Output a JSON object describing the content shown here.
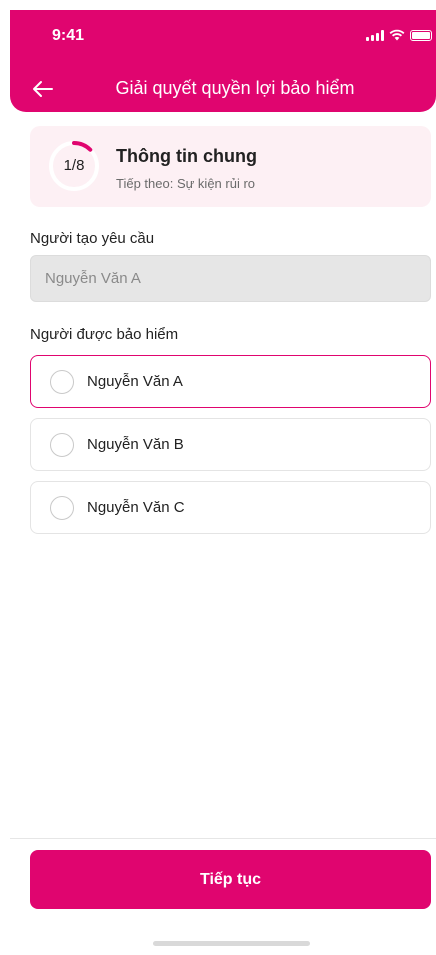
{
  "status_bar": {
    "time": "9:41"
  },
  "header": {
    "title": "Giải quyết quyền lợi bảo hiểm"
  },
  "progress": {
    "step_label": "1/8",
    "current": 1,
    "total": 8,
    "title": "Thông tin chung",
    "next": "Tiếp theo: Sự kiện rủi ro"
  },
  "requester": {
    "label": "Người tạo yêu cầu",
    "value": "Nguyễn Văn A"
  },
  "insured": {
    "label": "Người được bảo hiểm",
    "options": [
      {
        "label": "Nguyễn Văn A"
      },
      {
        "label": "Nguyễn Văn B"
      },
      {
        "label": "Nguyễn Văn C"
      }
    ]
  },
  "footer": {
    "continue_label": "Tiếp tục"
  },
  "colors": {
    "primary": "#e0056f",
    "card_bg": "#fdf0f4",
    "field_bg": "#e6e6e6"
  }
}
